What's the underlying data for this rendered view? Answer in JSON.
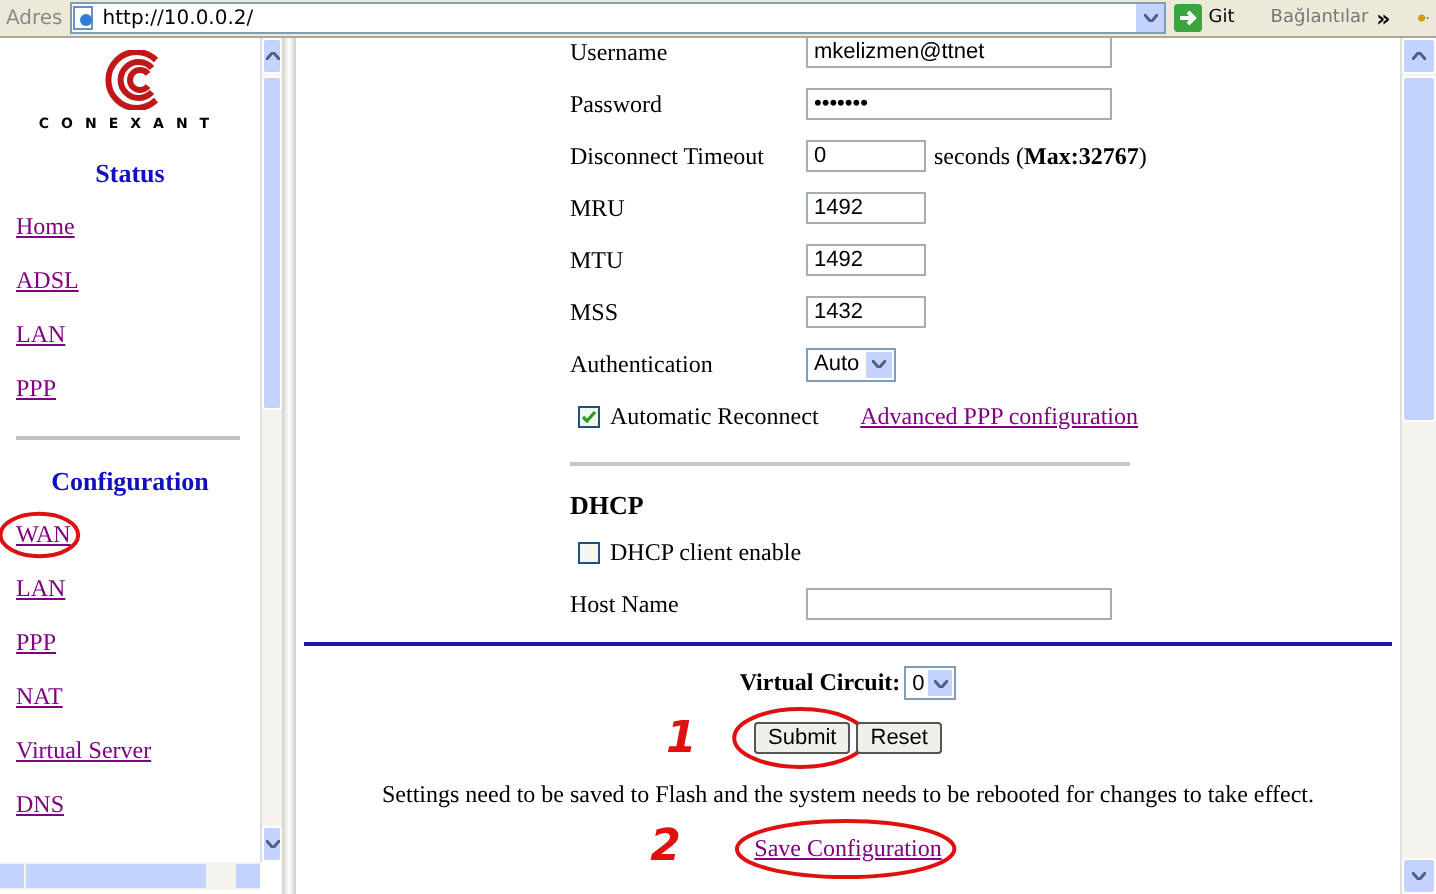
{
  "address_bar": {
    "label": "Adres",
    "url": "http://10.0.0.2/",
    "go": "Git",
    "links": "Bağlantılar",
    "more": "»"
  },
  "sidebar": {
    "logo_text": "CONEXANT",
    "sections": [
      {
        "title": "Status",
        "items": [
          {
            "label": "Home",
            "circled": false
          },
          {
            "label": "ADSL",
            "circled": false
          },
          {
            "label": "LAN",
            "circled": false
          },
          {
            "label": "PPP",
            "circled": false
          }
        ]
      },
      {
        "title": "Configuration",
        "items": [
          {
            "label": "WAN",
            "circled": true
          },
          {
            "label": "LAN",
            "circled": false
          },
          {
            "label": "PPP",
            "circled": false
          },
          {
            "label": "NAT",
            "circled": false
          },
          {
            "label": "Virtual Server",
            "circled": false
          },
          {
            "label": "DNS",
            "circled": false
          }
        ]
      }
    ]
  },
  "ppp_form": [
    {
      "kind": "wide_text",
      "label": "Username",
      "value": "mkelizmen@ttnet"
    },
    {
      "kind": "wide_text",
      "label": "Password",
      "value": "•••••••"
    },
    {
      "kind": "short_text",
      "label": "Disconnect Timeout",
      "value": "0",
      "suffix": "seconds (**Max:32767**)"
    },
    {
      "kind": "short_text",
      "label": "MRU",
      "value": "1492"
    },
    {
      "kind": "short_text",
      "label": "MTU",
      "value": "1492"
    },
    {
      "kind": "short_text",
      "label": "MSS",
      "value": "1432"
    },
    {
      "kind": "select",
      "label": "Authentication",
      "value": "Auto"
    },
    {
      "kind": "checkbox",
      "label": "Automatic Reconnect",
      "checked": true,
      "link": "Advanced PPP configuration"
    }
  ],
  "dhcp": {
    "heading": "DHCP",
    "rows": [
      {
        "kind": "checkbox",
        "label": "DHCP client enable",
        "checked": false
      },
      {
        "kind": "wide_text",
        "label": "Host Name"
      }
    ]
  },
  "footer": {
    "virtual_circuit": {
      "label": "Virtual Circuit:",
      "value": "0"
    },
    "buttons": [
      {
        "label": "Submit",
        "circled": true,
        "annotation": "1"
      },
      {
        "label": "Reset",
        "circled": false
      }
    ],
    "note": "Settings need to be saved to Flash and the system needs to be rebooted for changes to take effect.",
    "save_link": {
      "label": "Save Configuration",
      "circled": true,
      "annotation": "2"
    }
  }
}
